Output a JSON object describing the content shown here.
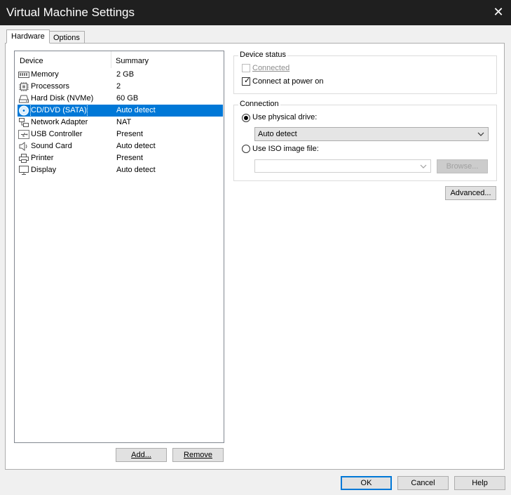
{
  "window": {
    "title": "Virtual Machine Settings"
  },
  "tabs": [
    {
      "label": "Hardware",
      "active": true
    },
    {
      "label": "Options",
      "active": false
    }
  ],
  "device_list": {
    "columns": {
      "device": "Device",
      "summary": "Summary"
    },
    "rows": [
      {
        "name": "Memory",
        "summary": "2 GB",
        "icon": "memory-icon",
        "selected": false
      },
      {
        "name": "Processors",
        "summary": "2",
        "icon": "processor-icon",
        "selected": false
      },
      {
        "name": "Hard Disk (NVMe)",
        "summary": "60 GB",
        "icon": "hard-disk-icon",
        "selected": false
      },
      {
        "name": "CD/DVD (SATA)",
        "summary": "Auto detect",
        "icon": "cd-dvd-icon",
        "selected": true
      },
      {
        "name": "Network Adapter",
        "summary": "NAT",
        "icon": "network-adapter-icon",
        "selected": false
      },
      {
        "name": "USB Controller",
        "summary": "Present",
        "icon": "usb-icon",
        "selected": false
      },
      {
        "name": "Sound Card",
        "summary": "Auto detect",
        "icon": "speaker-icon",
        "selected": false
      },
      {
        "name": "Printer",
        "summary": "Present",
        "icon": "printer-icon",
        "selected": false
      },
      {
        "name": "Display",
        "summary": "Auto detect",
        "icon": "monitor-icon",
        "selected": false
      }
    ]
  },
  "list_buttons": {
    "add": "Add...",
    "remove": "Remove"
  },
  "device_status": {
    "label": "Device status",
    "connected": {
      "label": "Connected",
      "checked": false,
      "enabled": false
    },
    "connect_at_power_on": {
      "label": "Connect at power on",
      "checked": true,
      "enabled": true
    }
  },
  "connection": {
    "label": "Connection",
    "use_physical_drive": {
      "label": "Use physical drive:",
      "selected": true
    },
    "physical_drive_value": "Auto detect",
    "use_iso": {
      "label": "Use ISO image file:",
      "selected": false
    },
    "iso_value": "",
    "browse": "Browse..."
  },
  "advanced_button": "Advanced...",
  "footer": {
    "ok": "OK",
    "cancel": "Cancel",
    "help": "Help"
  },
  "colors": {
    "selection": "#0078d7",
    "titlebar": "#1f1f1f"
  }
}
